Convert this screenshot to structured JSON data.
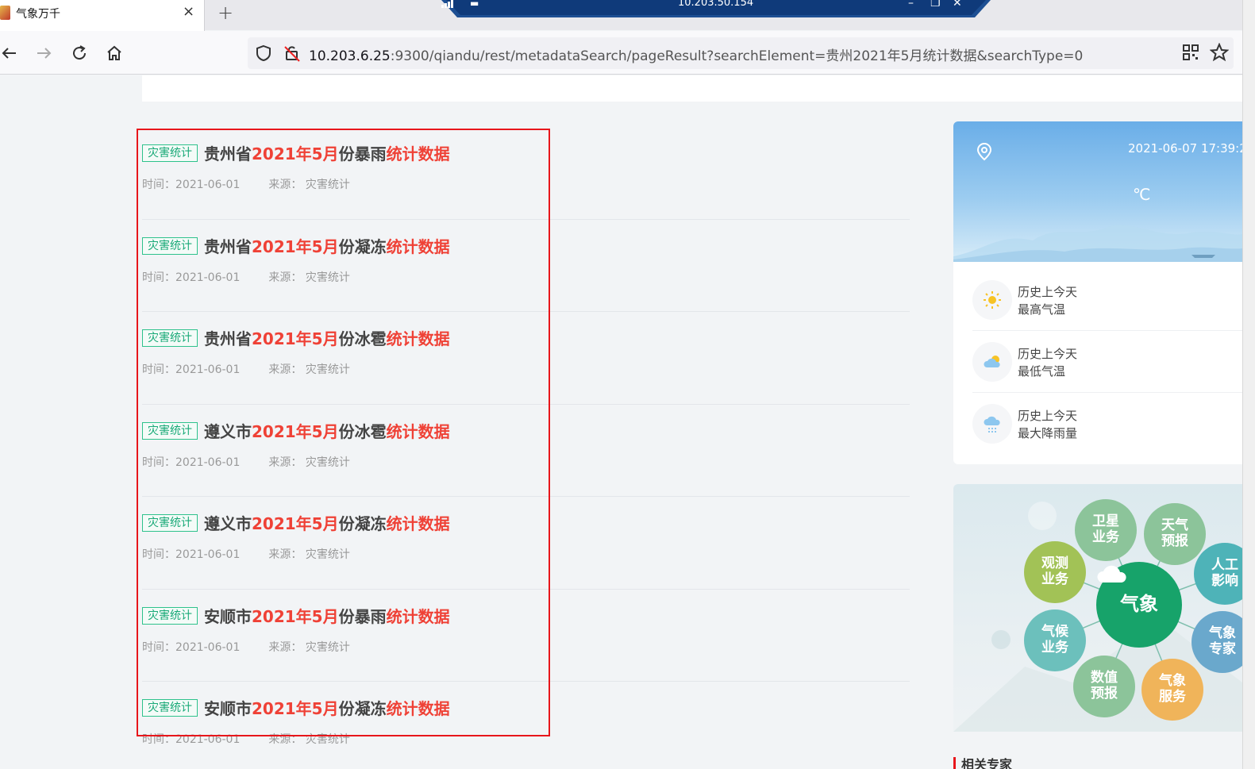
{
  "browser": {
    "tab_title": "气象万千",
    "url_host": "10.203.6.25",
    "url_rest": ":9300/qiandu/rest/metadataSearch/pageResult?searchElement=贵州2021年5月统计数据&searchType=0"
  },
  "remote_session": {
    "ip": "10.203.50.154"
  },
  "results": [
    {
      "tag": "灾害统计",
      "title_prefix": "贵州省",
      "title_mid1": "2021年5月",
      "title_mid2": "份暴雨",
      "title_suffix": "统计数据",
      "time": "时间：2021-06-01",
      "source": "来源： 灾害统计"
    },
    {
      "tag": "灾害统计",
      "title_prefix": "贵州省",
      "title_mid1": "2021年5月",
      "title_mid2": "份凝冻",
      "title_suffix": "统计数据",
      "time": "时间：2021-06-01",
      "source": "来源： 灾害统计"
    },
    {
      "tag": "灾害统计",
      "title_prefix": "贵州省",
      "title_mid1": "2021年5月",
      "title_mid2": "份冰雹",
      "title_suffix": "统计数据",
      "time": "时间：2021-06-01",
      "source": "来源： 灾害统计"
    },
    {
      "tag": "灾害统计",
      "title_prefix": "遵义市",
      "title_mid1": "2021年5月",
      "title_mid2": "份冰雹",
      "title_suffix": "统计数据",
      "time": "时间：2021-06-01",
      "source": "来源： 灾害统计"
    },
    {
      "tag": "灾害统计",
      "title_prefix": "遵义市",
      "title_mid1": "2021年5月",
      "title_mid2": "份凝冻",
      "title_suffix": "统计数据",
      "time": "时间：2021-06-01",
      "source": "来源： 灾害统计"
    },
    {
      "tag": "灾害统计",
      "title_prefix": "安顺市",
      "title_mid1": "2021年5月",
      "title_mid2": "份暴雨",
      "title_suffix": "统计数据",
      "time": "时间：2021-06-01",
      "source": "来源： 灾害统计"
    },
    {
      "tag": "灾害统计",
      "title_prefix": "安顺市",
      "title_mid1": "2021年5月",
      "title_mid2": "份凝冻",
      "title_suffix": "统计数据",
      "time": "时间：2021-06-01",
      "source": "来源： 灾害统计"
    }
  ],
  "weather": {
    "datetime": "2021-06-07 17:39:2",
    "unit": "℃",
    "history": [
      {
        "line1": "历史上今天",
        "line2": "最高气温",
        "icon": "sun-icon"
      },
      {
        "line1": "历史上今天",
        "line2": "最低气温",
        "icon": "cloud-icon"
      },
      {
        "line1": "历史上今天",
        "line2": "最大降雨量",
        "icon": "rain-cloud-icon"
      }
    ]
  },
  "services": {
    "center": "气象",
    "items": [
      {
        "label": "卫星业务",
        "color": "#8cc49a"
      },
      {
        "label": "天气预报",
        "color": "#8cc49a"
      },
      {
        "label": "观测业务",
        "color": "#a2c256"
      },
      {
        "label": "人工影响",
        "color": "#4eb3b8"
      },
      {
        "label": "气候业务",
        "color": "#6cc0bc"
      },
      {
        "label": "气象专家",
        "color": "#6aa8cc"
      },
      {
        "label": "数值预报",
        "color": "#8cc49a"
      },
      {
        "label": "气象服务",
        "color": "#f0b45a"
      }
    ]
  },
  "related_title": "相关专家",
  "colors": {
    "highlight": "#ef4136",
    "tag": "#1aaa78",
    "annotation": "#e8161b"
  }
}
